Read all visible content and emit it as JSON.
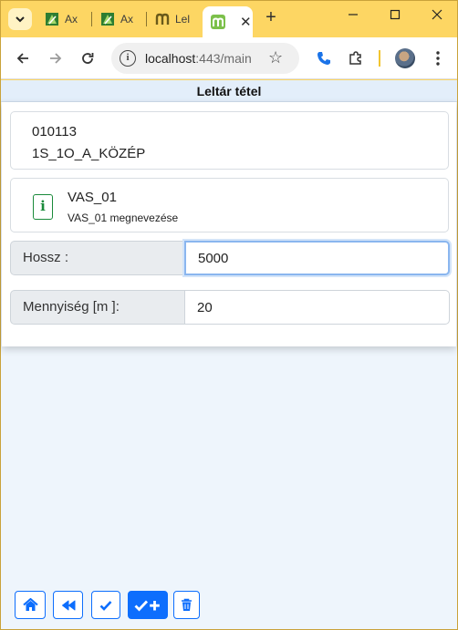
{
  "browser": {
    "tabs": [
      {
        "label": "Ax",
        "favicon": "green-leaf-icon"
      },
      {
        "label": "Ax",
        "favicon": "green-leaf-icon"
      },
      {
        "label": "Lel",
        "favicon": "m-logo-icon"
      }
    ],
    "active_tab": {
      "favicon": "m-logo-green-icon"
    },
    "url_host": "localhost",
    "url_rest": ":443/main",
    "colors": {
      "frame": "#fdd663",
      "accent": "#0d6efd"
    }
  },
  "page": {
    "title": "Leltár tétel",
    "location": {
      "code": "010113",
      "name": "1S_1O_A_KÖZÉP"
    },
    "item": {
      "code": "VAS_01",
      "description": "VAS_01 megnevezése",
      "icon": "info-icon"
    },
    "fields": [
      {
        "label": "Hossz :",
        "value": "5000"
      },
      {
        "label": "Mennyiség [m ]:",
        "value": "20"
      }
    ],
    "actions": [
      "home-icon",
      "rewind-icon",
      "check-icon",
      "check-plus-icon",
      "trash-icon"
    ]
  }
}
